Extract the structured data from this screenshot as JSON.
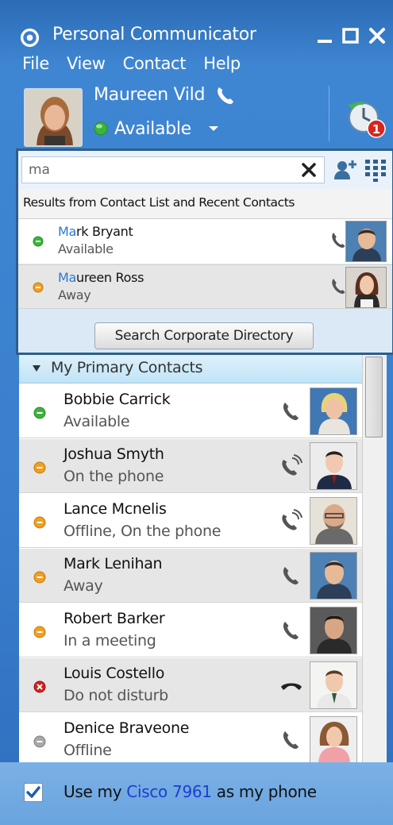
{
  "app": {
    "title": "Personal Communicator"
  },
  "menu": [
    "File",
    "View",
    "Contact",
    "Help"
  ],
  "user": {
    "name": "Maureen Vild",
    "status": "Available",
    "recent_badge": "1"
  },
  "search": {
    "value": "ma",
    "results_header": "Results from Contact List and Recent Contacts",
    "results": [
      {
        "highlight": "Ma",
        "rest": "rk Bryant",
        "status": "Available",
        "presence": "available"
      },
      {
        "highlight": "Ma",
        "rest": "ureen Ross",
        "status": "Away",
        "presence": "away"
      }
    ],
    "corporate_button": "Search Corporate Directory"
  },
  "contacts": {
    "group_label": "My Primary Contacts",
    "items": [
      {
        "name": "Bobbie Carrick",
        "status": "Available",
        "presence": "available",
        "phone_icon": "phone-icon"
      },
      {
        "name": "Joshua Smyth",
        "status": "On the phone",
        "presence": "away",
        "phone_icon": "phone-ringing-icon"
      },
      {
        "name": "Lance Mcnelis",
        "status": "Offline, On the phone",
        "presence": "away",
        "phone_icon": "phone-ringing-icon"
      },
      {
        "name": "Mark Lenihan",
        "status": "Away",
        "presence": "away",
        "phone_icon": "phone-icon"
      },
      {
        "name": "Robert Barker",
        "status": "In a meeting",
        "presence": "away",
        "phone_icon": "phone-icon"
      },
      {
        "name": "Louis Costello",
        "status": "Do not disturb",
        "presence": "dnd",
        "phone_icon": "hang-up-icon"
      },
      {
        "name": "Denice Braveone",
        "status": "Offline",
        "presence": "offline",
        "phone_icon": "phone-icon"
      }
    ]
  },
  "footer": {
    "text_before": "Use my ",
    "device_link": "Cisco 7961",
    "text_after": " as my phone",
    "checked": true
  },
  "colors": {
    "title_bar": "#3a7fcd",
    "panel_border": "#2b5f8e",
    "available": "#3cb43c",
    "away": "#f0a020",
    "dnd": "#d42020",
    "offline": "#a8a8a8",
    "link": "#1a3fd0"
  }
}
